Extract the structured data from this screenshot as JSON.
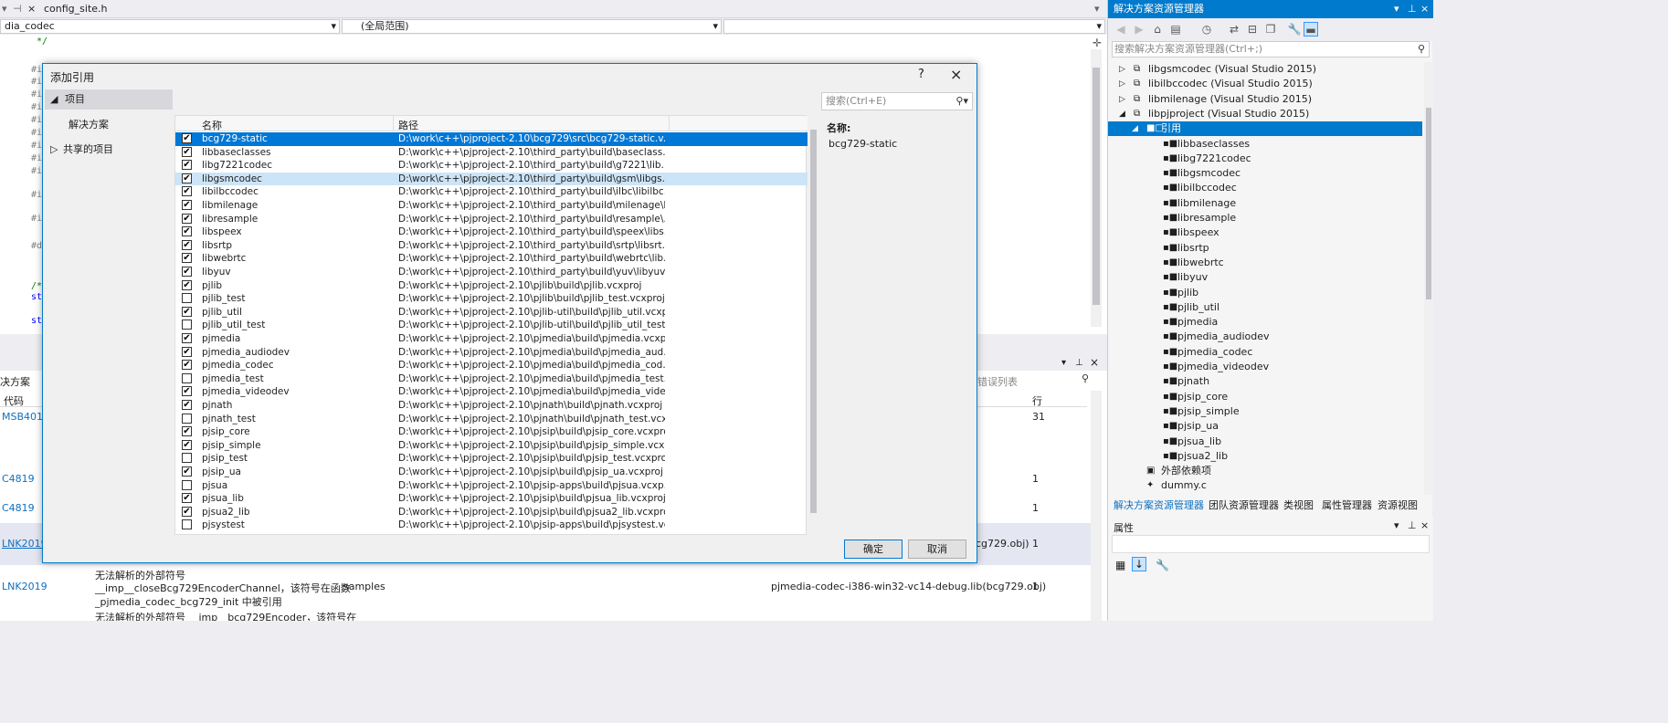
{
  "editor": {
    "tab_close": "×",
    "tab_label": "config_site.h",
    "nav_left": "dia_codec",
    "nav_mid": "(全局范围)",
    "comment_line": " */",
    "code_prefixes": [
      "#i",
      "#i",
      "#i",
      "#i",
      "#i",
      "#i",
      "#i",
      "#i",
      "#i",
      "#i",
      "#i",
      "#d",
      "/*",
      "st",
      "st"
    ]
  },
  "errlist": {
    "left_label": "决方案",
    "filter_label": "错误列表",
    "col_code": "代码",
    "col_line": "行",
    "rows": [
      {
        "code": "MSB4011",
        "line": "31"
      },
      {
        "code": "C4819",
        "line": "1"
      },
      {
        "code": "C4819",
        "line": "1"
      },
      {
        "code": "LNK2019",
        "file": "cg729.obj)",
        "line": "1"
      },
      {
        "code": "LNK2019",
        "desc1": "无法解析的外部符号",
        "desc2": "__imp__closeBcg729EncoderChannel，该符号在函数",
        "desc3": "_pjmedia_codec_bcg729_init 中被引用",
        "project": "samples",
        "file": "pjmedia-codec-i386-win32-vc14-debug.lib(bcg729.obj)",
        "line": "1"
      },
      {
        "code": "LNK2019",
        "desc1": "无法解析的外部符号 __imp__bcg729Encoder，该符号在"
      }
    ]
  },
  "solution_explorer": {
    "title": "解决方案资源管理器",
    "search_placeholder": "搜索解决方案资源管理器(Ctrl+;)",
    "projects": [
      "libgsmcodec (Visual Studio 2015)",
      "libilbccodec (Visual Studio 2015)",
      "libmilenage (Visual Studio 2015)",
      "libpjproject (Visual Studio 2015)"
    ],
    "refs_label": "引用",
    "refs": [
      "libbaseclasses",
      "libg7221codec",
      "libgsmcodec",
      "libilbccodec",
      "libmilenage",
      "libresample",
      "libspeex",
      "libsrtp",
      "libwebrtc",
      "libyuv",
      "pjlib",
      "pjlib_util",
      "pjmedia",
      "pjmedia_audiodev",
      "pjmedia_codec",
      "pjmedia_videodev",
      "pjnath",
      "pjsip_core",
      "pjsip_simple",
      "pjsip_ua",
      "pjsua_lib",
      "pjsua2_lib"
    ],
    "external_deps": "外部依赖项",
    "dummy": "dummy.c",
    "tabs": [
      "解决方案资源管理器",
      "团队资源管理器",
      "类视图",
      "属性管理器",
      "资源视图"
    ],
    "properties_title": "属性"
  },
  "dialog": {
    "title": "添加引用",
    "help": "?",
    "close": "×",
    "left_nav": {
      "projects": "项目",
      "solution": "解决方案",
      "shared": "共享的项目"
    },
    "col_name": "名称",
    "col_path": "路径",
    "search_placeholder": "搜索(Ctrl+E)",
    "info_label": "名称:",
    "info_value": "bcg729-static",
    "ok": "确定",
    "cancel": "取消",
    "rows": [
      {
        "name": "bcg729-static",
        "path": "D:\\work\\c++\\pjproject-2.10\\bcg729\\src\\bcg729-static.v...",
        "checked": true
      },
      {
        "name": "libbaseclasses",
        "path": "D:\\work\\c++\\pjproject-2.10\\third_party\\build\\baseclass...",
        "checked": true
      },
      {
        "name": "libg7221codec",
        "path": "D:\\work\\c++\\pjproject-2.10\\third_party\\build\\g7221\\lib...",
        "checked": true
      },
      {
        "name": "libgsmcodec",
        "path": "D:\\work\\c++\\pjproject-2.10\\third_party\\build\\gsm\\libgs...",
        "checked": true
      },
      {
        "name": "libilbccodec",
        "path": "D:\\work\\c++\\pjproject-2.10\\third_party\\build\\ilbc\\libilbc...",
        "checked": true
      },
      {
        "name": "libmilenage",
        "path": "D:\\work\\c++\\pjproject-2.10\\third_party\\build\\milenage\\l...",
        "checked": true
      },
      {
        "name": "libresample",
        "path": "D:\\work\\c++\\pjproject-2.10\\third_party\\build\\resample\\...",
        "checked": true
      },
      {
        "name": "libspeex",
        "path": "D:\\work\\c++\\pjproject-2.10\\third_party\\build\\speex\\libs...",
        "checked": true
      },
      {
        "name": "libsrtp",
        "path": "D:\\work\\c++\\pjproject-2.10\\third_party\\build\\srtp\\libsrt...",
        "checked": true
      },
      {
        "name": "libwebrtc",
        "path": "D:\\work\\c++\\pjproject-2.10\\third_party\\build\\webrtc\\lib...",
        "checked": true
      },
      {
        "name": "libyuv",
        "path": "D:\\work\\c++\\pjproject-2.10\\third_party\\build\\yuv\\libyuv....",
        "checked": true
      },
      {
        "name": "pjlib",
        "path": "D:\\work\\c++\\pjproject-2.10\\pjlib\\build\\pjlib.vcxproj",
        "checked": true
      },
      {
        "name": "pjlib_test",
        "path": "D:\\work\\c++\\pjproject-2.10\\pjlib\\build\\pjlib_test.vcxproj",
        "checked": false
      },
      {
        "name": "pjlib_util",
        "path": "D:\\work\\c++\\pjproject-2.10\\pjlib-util\\build\\pjlib_util.vcxp...",
        "checked": true
      },
      {
        "name": "pjlib_util_test",
        "path": "D:\\work\\c++\\pjproject-2.10\\pjlib-util\\build\\pjlib_util_test....",
        "checked": false
      },
      {
        "name": "pjmedia",
        "path": "D:\\work\\c++\\pjproject-2.10\\pjmedia\\build\\pjmedia.vcxp...",
        "checked": true
      },
      {
        "name": "pjmedia_audiodev",
        "path": "D:\\work\\c++\\pjproject-2.10\\pjmedia\\build\\pjmedia_aud...",
        "checked": true
      },
      {
        "name": "pjmedia_codec",
        "path": "D:\\work\\c++\\pjproject-2.10\\pjmedia\\build\\pjmedia_cod...",
        "checked": true
      },
      {
        "name": "pjmedia_test",
        "path": "D:\\work\\c++\\pjproject-2.10\\pjmedia\\build\\pjmedia_test....",
        "checked": false
      },
      {
        "name": "pjmedia_videodev",
        "path": "D:\\work\\c++\\pjproject-2.10\\pjmedia\\build\\pjmedia_vide...",
        "checked": true
      },
      {
        "name": "pjnath",
        "path": "D:\\work\\c++\\pjproject-2.10\\pjnath\\build\\pjnath.vcxproj",
        "checked": true
      },
      {
        "name": "pjnath_test",
        "path": "D:\\work\\c++\\pjproject-2.10\\pjnath\\build\\pjnath_test.vcx...",
        "checked": false
      },
      {
        "name": "pjsip_core",
        "path": "D:\\work\\c++\\pjproject-2.10\\pjsip\\build\\pjsip_core.vcxproj",
        "checked": true
      },
      {
        "name": "pjsip_simple",
        "path": "D:\\work\\c++\\pjproject-2.10\\pjsip\\build\\pjsip_simple.vcx...",
        "checked": true
      },
      {
        "name": "pjsip_test",
        "path": "D:\\work\\c++\\pjproject-2.10\\pjsip\\build\\pjsip_test.vcxproj",
        "checked": false
      },
      {
        "name": "pjsip_ua",
        "path": "D:\\work\\c++\\pjproject-2.10\\pjsip\\build\\pjsip_ua.vcxproj",
        "checked": true
      },
      {
        "name": "pjsua",
        "path": "D:\\work\\c++\\pjproject-2.10\\pjsip-apps\\build\\pjsua.vcxp...",
        "checked": false
      },
      {
        "name": "pjsua_lib",
        "path": "D:\\work\\c++\\pjproject-2.10\\pjsip\\build\\pjsua_lib.vcxproj",
        "checked": true
      },
      {
        "name": "pjsua2_lib",
        "path": "D:\\work\\c++\\pjproject-2.10\\pjsip\\build\\pjsua2_lib.vcxproj",
        "checked": true
      },
      {
        "name": "pjsystest",
        "path": "D:\\work\\c++\\pjproject-2.10\\pjsip-apps\\build\\pjsystest.vc...",
        "checked": false
      }
    ]
  }
}
